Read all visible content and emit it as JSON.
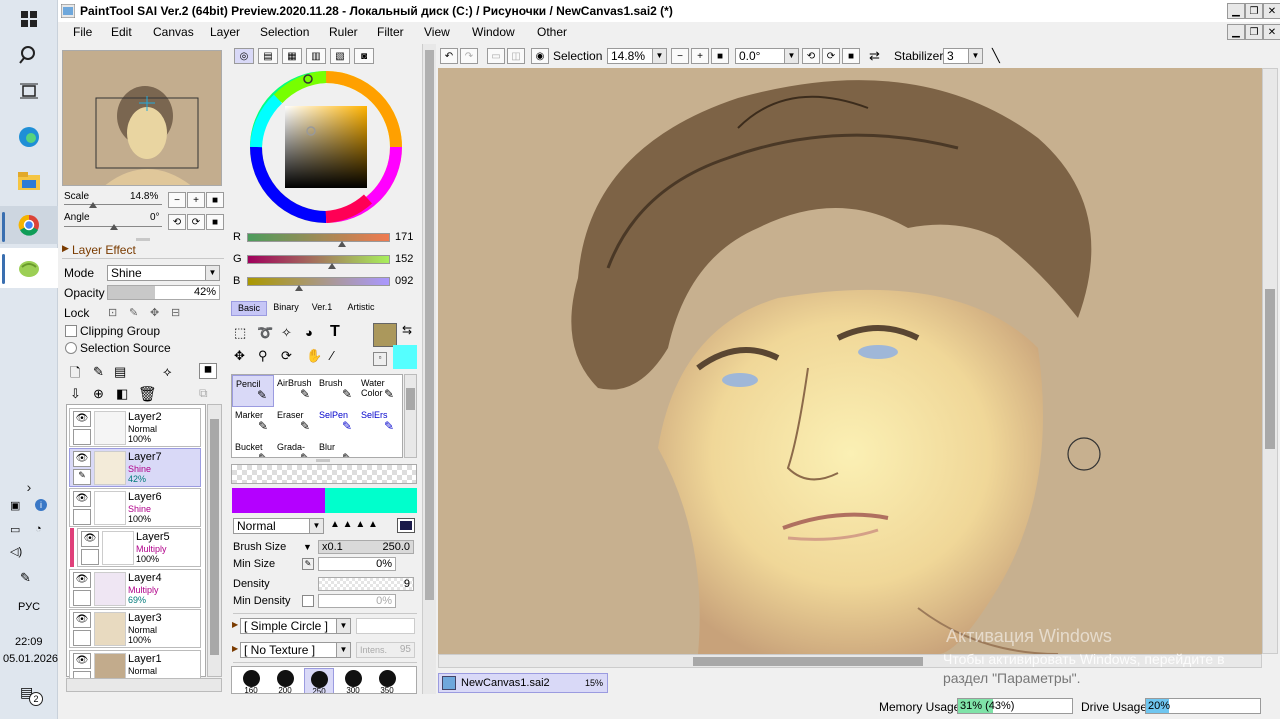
{
  "taskbar": {
    "lang": "РУС",
    "time": "22:09",
    "date": "05.01.2026",
    "notif_count": "2"
  },
  "window": {
    "title": "PaintTool SAI Ver.2 (64bit) Preview.2020.11.28 - Локальный диск (C:) / Рисуночки / NewCanvas1.sai2 (*)"
  },
  "menu": [
    "File",
    "Edit",
    "Canvas",
    "Layer",
    "Selection",
    "Ruler",
    "Filter",
    "View",
    "Window",
    "Other"
  ],
  "toolbar": {
    "selection_label": "Selection",
    "zoom": "14.8%",
    "rotation": "0.0°",
    "stabilizer_label": "Stabilizer",
    "stabilizer_value": "3"
  },
  "navigator": {
    "scale_label": "Scale",
    "scale_value": "14.8%",
    "angle_label": "Angle",
    "angle_value": "0°"
  },
  "layer_effect": {
    "title": "Layer Effect",
    "mode_label": "Mode",
    "mode_value": "Shine",
    "opacity_label": "Opacity",
    "opacity_value": "42%",
    "opacity_fraction": 0.42,
    "lock_label": "Lock",
    "clipping_label": "Clipping Group",
    "selection_source_label": "Selection Source"
  },
  "layers": [
    {
      "name": "Layer2",
      "mode": "Normal",
      "opacity": "100%",
      "mode_color": "#000000"
    },
    {
      "name": "Layer7",
      "mode": "Shine",
      "opacity": "42%",
      "mode_color": "#b0008a"
    },
    {
      "name": "Layer6",
      "mode": "Shine",
      "opacity": "100%",
      "mode_color": "#b0008a"
    },
    {
      "name": "Layer5",
      "mode": "Multiply",
      "opacity": "100%",
      "mode_color": "#b0008a"
    },
    {
      "name": "Layer4",
      "mode": "Multiply",
      "opacity": "69%",
      "mode_color": "#b0008a"
    },
    {
      "name": "Layer3",
      "mode": "Normal",
      "opacity": "100%",
      "mode_color": "#000000"
    },
    {
      "name": "Layer1",
      "mode": "Normal",
      "opacity": "",
      "mode_color": "#000000"
    }
  ],
  "color": {
    "r_label": "R",
    "r_value": "171",
    "g_label": "G",
    "g_value": "152",
    "b_label": "B",
    "b_value": "092",
    "primary": "#ab985c",
    "secondary": "#55ffff"
  },
  "tool_tabs": [
    "Basic",
    "Binary",
    "Ver.1",
    "Artistic"
  ],
  "tools": [
    {
      "label": "Pencil",
      "icon": "pencil-icon"
    },
    {
      "label": "AirBrush",
      "icon": "airbrush-icon"
    },
    {
      "label": "Brush",
      "icon": "brush-icon"
    },
    {
      "label": "Water Color",
      "icon": "watercolor-icon"
    },
    {
      "label": "Marker",
      "icon": "marker-icon"
    },
    {
      "label": "Eraser",
      "icon": "eraser-icon"
    },
    {
      "label": "SelPen",
      "icon": "selpen-icon"
    },
    {
      "label": "SelErs",
      "icon": "selers-icon"
    },
    {
      "label": "Bucket",
      "icon": "bucket-icon"
    },
    {
      "label": "Grada-",
      "icon": "gradation-icon"
    },
    {
      "label": "Blur",
      "icon": "blur-icon"
    }
  ],
  "brush": {
    "blend_mode": "Normal",
    "size_label": "Brush Size",
    "size_mult": "x0.1",
    "size_value": "250.0",
    "min_size_label": "Min Size",
    "min_size_value": "0%",
    "density_label": "Density",
    "density_value": "9",
    "min_density_label": "Min Density",
    "min_density_value": "0%",
    "shape": "[ Simple Circle ]",
    "texture": "[ No Texture ]",
    "intensity_label": "Intens.",
    "intensity_value": "95",
    "sizes": [
      "160",
      "200",
      "250",
      "300",
      "350"
    ]
  },
  "canvas_tab": {
    "name": "NewCanvas1.sai2",
    "zoom": "15%"
  },
  "watermark": {
    "line1": "Активация Windows",
    "line2": "Чтобы активировать Windows, перейдите в",
    "line3": "раздел \"Параметры\"."
  },
  "status": {
    "memory_label": "Memory Usage",
    "memory_value": "31% (43%)",
    "memory_fraction": 0.31,
    "drive_label": "Drive Usage",
    "drive_value": "20%",
    "drive_fraction": 0.2
  }
}
